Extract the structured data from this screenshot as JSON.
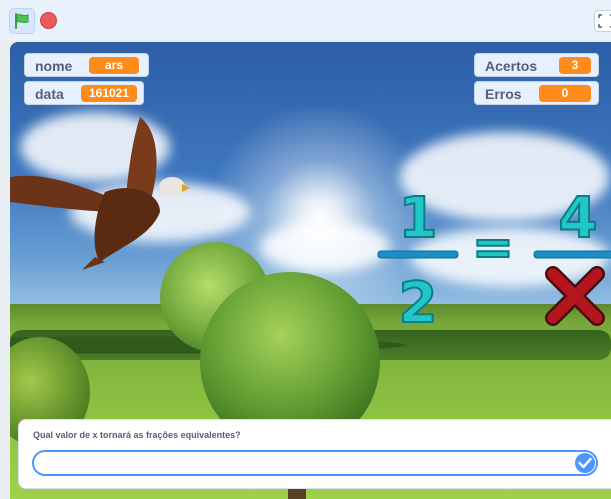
{
  "toolbar": {
    "green_flag_icon": "green-flag-icon",
    "stop_icon": "stop-sign-icon",
    "fullscreen_icon": "fullscreen-icon",
    "green_flag_color": "#4cbf56",
    "stop_color": "#ec5959"
  },
  "monitors": {
    "nome": {
      "label": "nome",
      "value": "ars"
    },
    "data": {
      "label": "data",
      "value": "161021"
    },
    "acertos": {
      "label": "Acertos",
      "value": "3"
    },
    "erros": {
      "label": "Erros",
      "value": "0"
    }
  },
  "fraction": {
    "left_numerator": "1",
    "left_denominator": "2",
    "equals": "=",
    "right_numerator": "4",
    "right_denominator_icon": "red-x-icon"
  },
  "ask": {
    "question": "Qual valor de x tornará as frações equivalentes?",
    "answer": "",
    "submit_icon": "check-icon"
  },
  "colors": {
    "monitor_value_bg": "#ff8c1a",
    "digit_fill": "#21c6c6",
    "input_border": "#4c97ff"
  }
}
